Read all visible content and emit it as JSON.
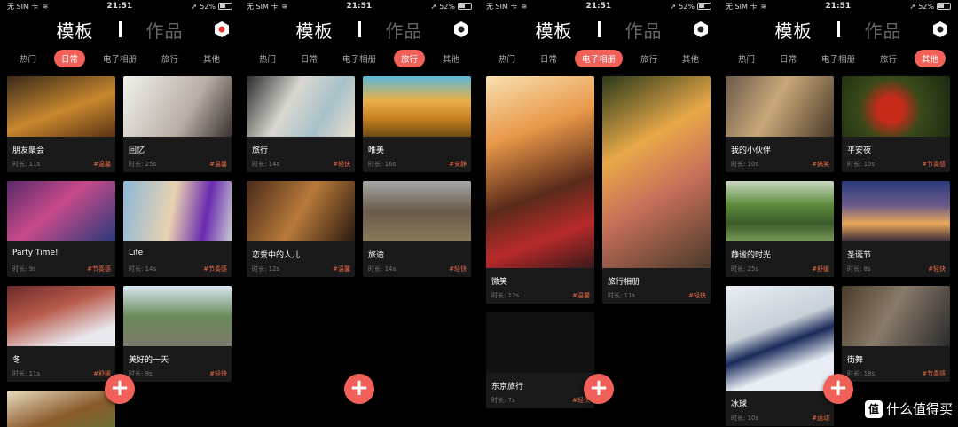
{
  "status": {
    "carrier": "无 SIM 卡",
    "time": "21:51",
    "battery": "52%"
  },
  "header": {
    "left": "模板",
    "right": "作品"
  },
  "tabs": [
    "热门",
    "日常",
    "电子相册",
    "旅行",
    "其他"
  ],
  "duration_prefix": "时长:",
  "screens": [
    {
      "active_tab": 1,
      "cards": [
        {
          "title": "朋友聚会",
          "duration": "时长: 11s",
          "tag": "#温馨"
        },
        {
          "title": "回忆",
          "duration": "时长: 25s",
          "tag": "#温馨"
        },
        {
          "title": "Party Time!",
          "duration": "时长: 9s",
          "tag": "#节奏感"
        },
        {
          "title": "Life",
          "duration": "时长: 14s",
          "tag": "#节奏感"
        },
        {
          "title": "冬",
          "duration": "时长: 11s",
          "tag": "#舒缓"
        },
        {
          "title": "美好的一天",
          "duration": "时长: 9s",
          "tag": "#轻快"
        },
        {
          "title": "",
          "duration": "",
          "tag": ""
        }
      ]
    },
    {
      "active_tab": 3,
      "cards": [
        {
          "title": "旅行",
          "duration": "时长: 14s",
          "tag": "#轻快"
        },
        {
          "title": "唯美",
          "duration": "时长: 16s",
          "tag": "#安静"
        },
        {
          "title": "恋爱中的人儿",
          "duration": "时长: 12s",
          "tag": "#温馨"
        },
        {
          "title": "旅途",
          "duration": "时长: 14s",
          "tag": "#轻快"
        }
      ]
    },
    {
      "active_tab": 2,
      "cards": [
        {
          "title": "微笑",
          "duration": "时长: 12s",
          "tag": "#温馨"
        },
        {
          "title": "旅行相册",
          "duration": "时长: 11s",
          "tag": "#轻快"
        },
        {
          "title": "东京旅行",
          "duration": "时长: 7s",
          "tag": "#轻快"
        }
      ]
    },
    {
      "active_tab": 4,
      "cards": [
        {
          "title": "我的小伙伴",
          "duration": "时长: 10s",
          "tag": "#搞笑"
        },
        {
          "title": "平安夜",
          "duration": "时长: 10s",
          "tag": "#节奏感"
        },
        {
          "title": "静谧的时光",
          "duration": "时长: 25s",
          "tag": "#舒缓"
        },
        {
          "title": "圣诞节",
          "duration": "时长: 8s",
          "tag": "#轻快"
        },
        {
          "title": "冰球",
          "duration": "时长: 10s",
          "tag": "#运动"
        },
        {
          "title": "街舞",
          "duration": "时长: 18s",
          "tag": "#节奏感"
        }
      ]
    }
  ],
  "watermark": {
    "logo": "值",
    "text": "什么值得买"
  },
  "colors": {
    "accent": "#f2605a",
    "tag": "#e86b4a",
    "card_bg": "#1a1a1a"
  }
}
